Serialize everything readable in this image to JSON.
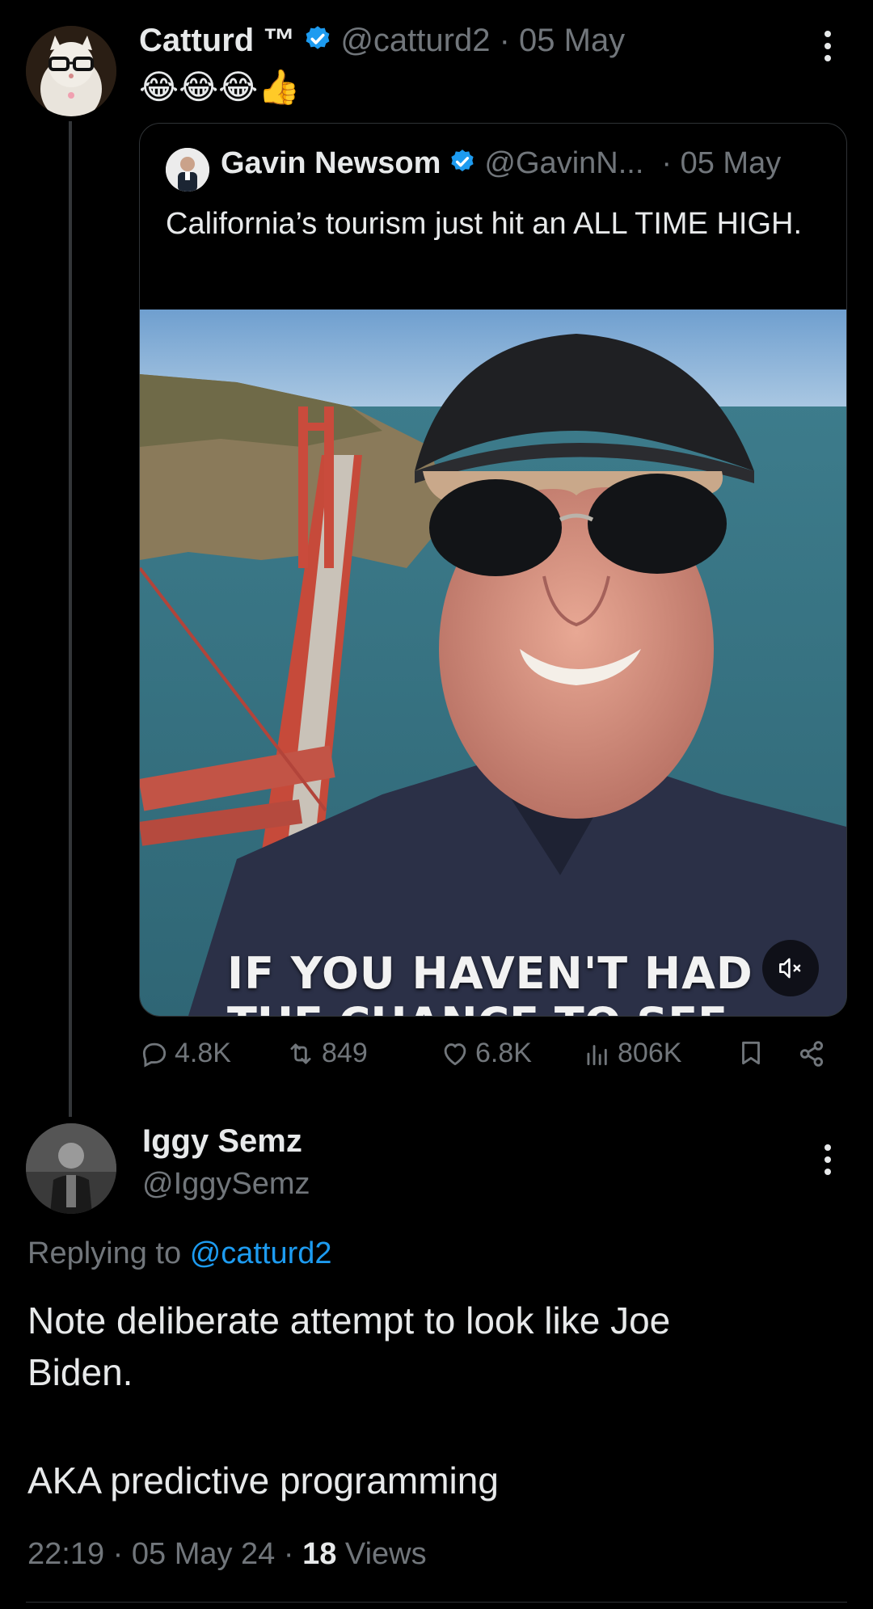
{
  "tweet1": {
    "author_name": "Catturd ™",
    "handle_date": "@catturd2 · 05 May",
    "text": "😂😂😂👍",
    "quoted": {
      "author_name": "Gavin Newsom",
      "handle": "@GavinN...",
      "date": "· 05 May",
      "text": "California’s tourism just hit an ALL TIME HIGH.",
      "video_caption_line1": "IF YOU HAVEN'T HAD",
      "video_caption_line2": "THE CHANCE TO SEE"
    },
    "stats": {
      "replies": "4.8K",
      "retweets": "849",
      "likes": "6.8K",
      "views": "806K"
    }
  },
  "tweet2": {
    "author_name": "Iggy Semz",
    "handle": "@IggySemz",
    "replying_label": "Replying to",
    "replying_handle": "@catturd2",
    "text_line1": "Note deliberate attempt to look like Joe",
    "text_line2": "Biden.",
    "text_line3": "AKA predictive programming",
    "meta_time": "22:19 · 05 May 24 · ",
    "meta_views_count": "18",
    "meta_views_label": " Views"
  },
  "colors": {
    "background": "#000000",
    "text": "#e7e9ea",
    "muted": "#71767b",
    "link": "#1d9bf0",
    "verified": "#1d9bf0"
  },
  "icons": [
    "verified-badge-icon",
    "more-icon",
    "reply-icon",
    "retweet-icon",
    "like-icon",
    "views-icon",
    "bookmark-icon",
    "share-icon",
    "mute-icon"
  ]
}
